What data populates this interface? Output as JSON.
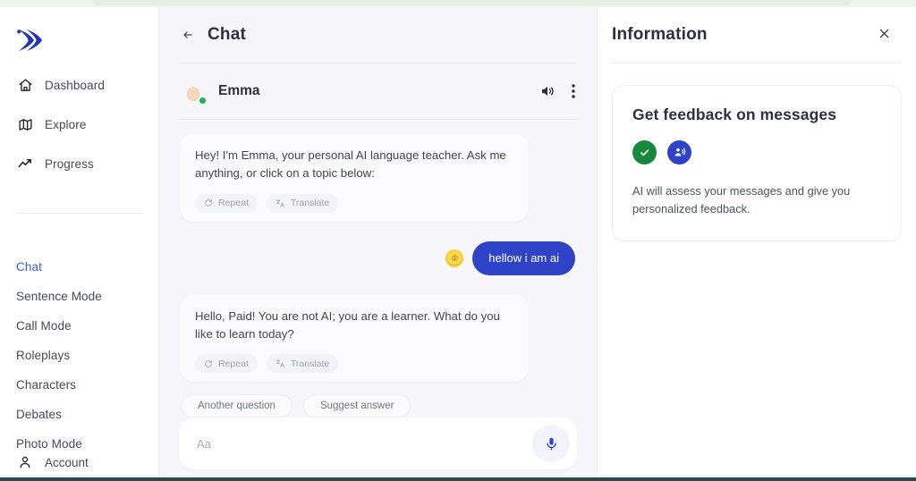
{
  "theme": {
    "accent_blue": "#2f43c9",
    "active_nav_blue": "#3b5bdb",
    "status_green": "#19b35a",
    "badge_green": "#16893d",
    "chat_bg": "#f7f7fb",
    "top_strip_green": "#eef6ec"
  },
  "sidebar": {
    "logo_name": "app-logo",
    "nav": [
      {
        "label": "Dashboard",
        "icon": "home-icon"
      },
      {
        "label": "Explore",
        "icon": "map-icon"
      },
      {
        "label": "Progress",
        "icon": "trending-up-icon"
      }
    ],
    "modes": [
      {
        "label": "Chat",
        "active": true
      },
      {
        "label": "Sentence Mode",
        "active": false
      },
      {
        "label": "Call Mode",
        "active": false
      },
      {
        "label": "Roleplays",
        "active": false
      },
      {
        "label": "Characters",
        "active": false
      },
      {
        "label": "Debates",
        "active": false
      },
      {
        "label": "Photo Mode",
        "active": false
      }
    ],
    "account": {
      "label": "Account",
      "icon": "person-icon"
    }
  },
  "chat": {
    "back_icon": "arrow-left-icon",
    "title": "Chat",
    "persona": {
      "name": "Emma",
      "status": "online",
      "avatar_alt": "Emma avatar",
      "speaker_icon": "speaker-icon",
      "menu_icon": "more-vertical-icon"
    },
    "messages": [
      {
        "role": "assistant",
        "text": "Hey! I'm Emma, your personal AI language teacher. Ask me anything, or click on a topic below:",
        "actions": [
          {
            "label": "Repeat",
            "icon": "refresh-icon"
          },
          {
            "label": "Translate",
            "icon": "translate-icon"
          }
        ]
      },
      {
        "role": "user",
        "text": "hellow i am ai",
        "avatar_icon": "coin-avatar"
      },
      {
        "role": "assistant",
        "text": "Hello, Paid! You are not AI; you are a learner. What do you like to learn today?",
        "actions": [
          {
            "label": "Repeat",
            "icon": "refresh-icon"
          },
          {
            "label": "Translate",
            "icon": "translate-icon"
          }
        ]
      }
    ],
    "suggestions": [
      {
        "label": "Another question"
      },
      {
        "label": "Suggest answer"
      }
    ],
    "composer": {
      "placeholder": "Aa",
      "value": "",
      "mic_icon": "microphone-icon"
    }
  },
  "info_panel": {
    "title": "Information",
    "close_icon": "close-icon",
    "card": {
      "title": "Get feedback on messages",
      "badges": [
        {
          "name": "check-badge",
          "icon": "check-icon"
        },
        {
          "name": "voice-badge",
          "icon": "person-speaking-icon"
        }
      ],
      "description": "AI will assess your messages and give you personalized feedback."
    }
  }
}
